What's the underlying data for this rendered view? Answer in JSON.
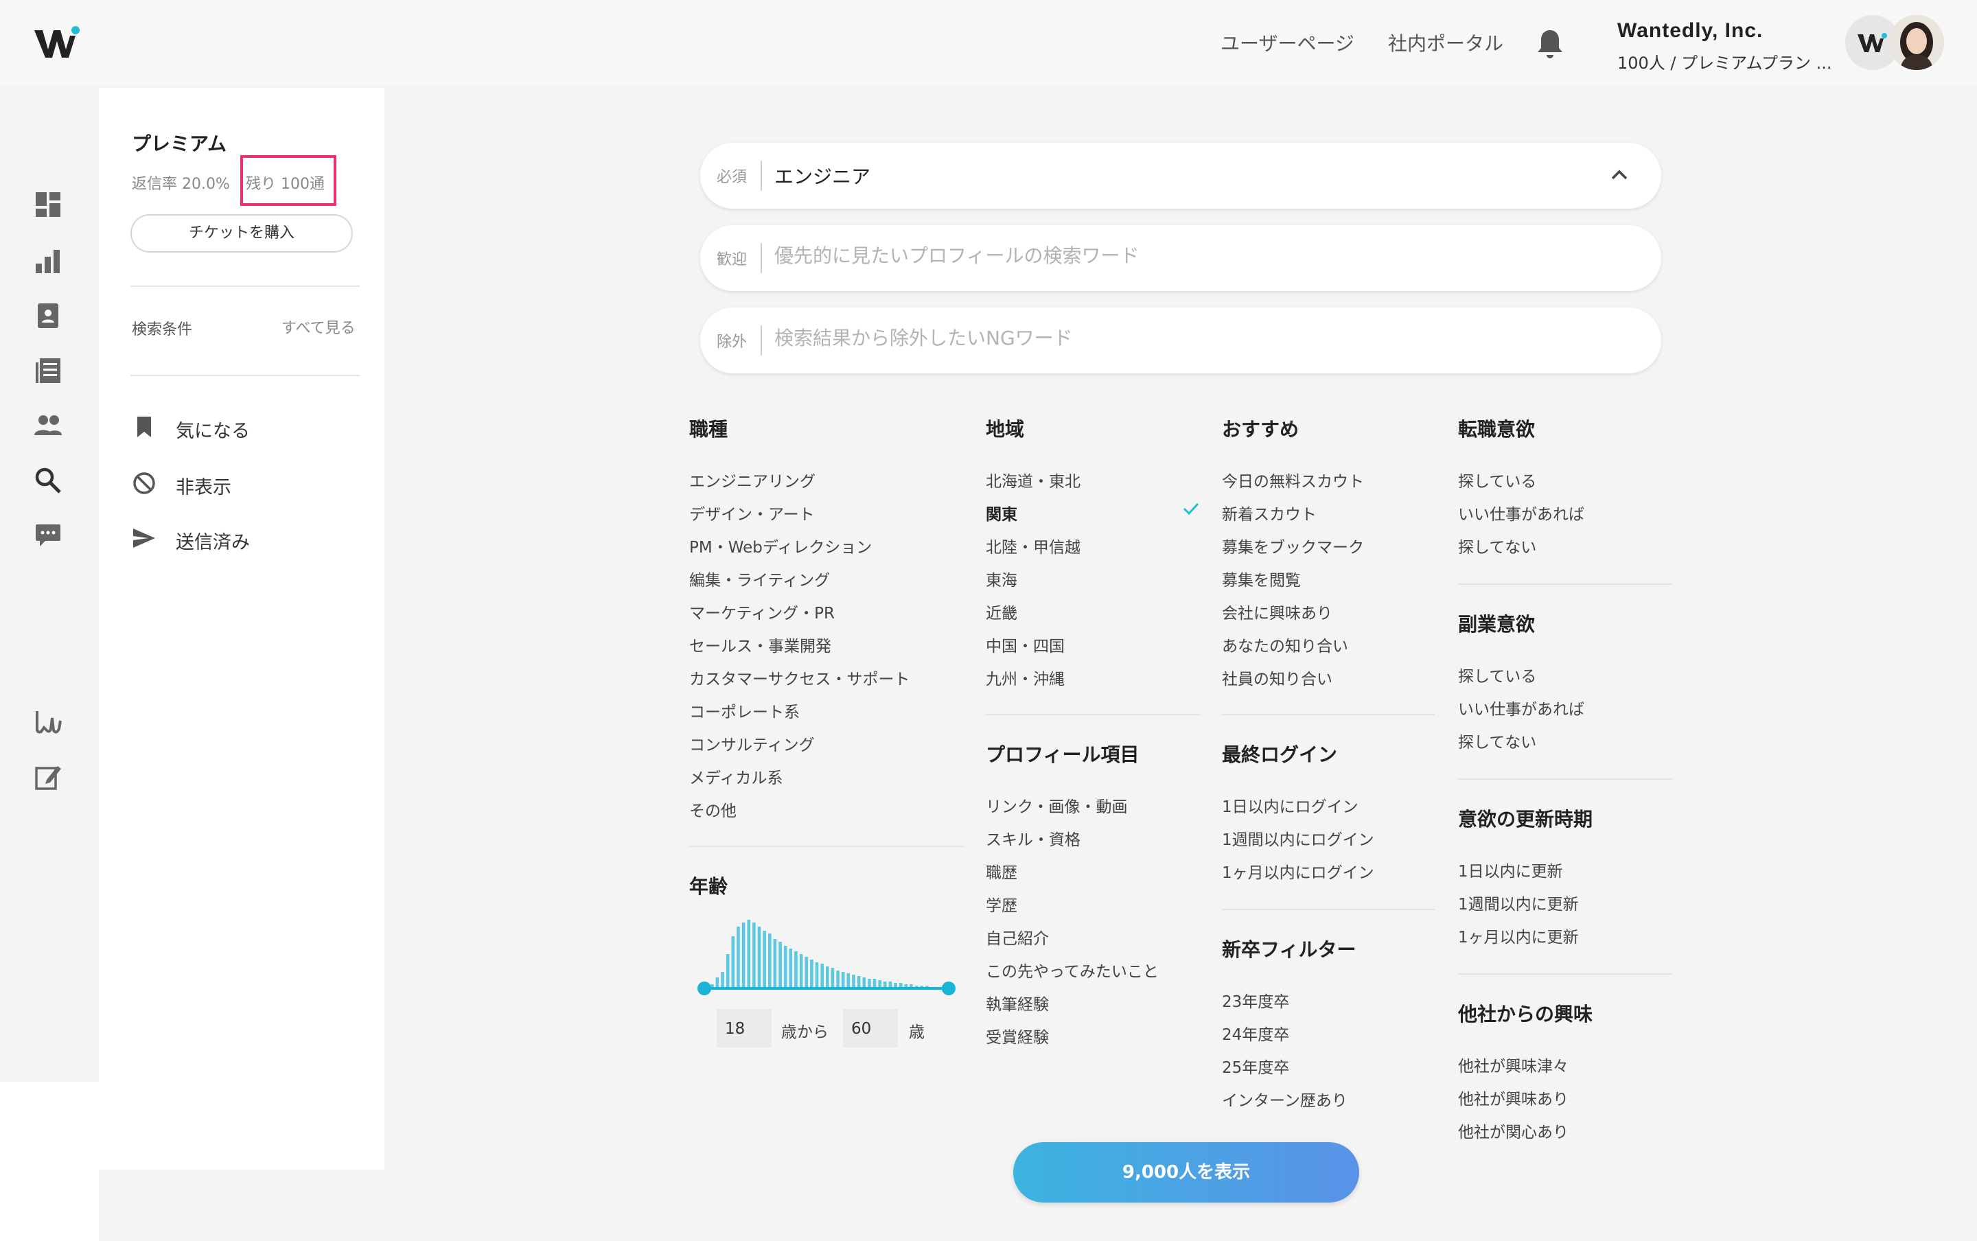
{
  "header": {
    "logo": "wantedly-logo",
    "user_page": "ユーザーページ",
    "portal": "社内ポータル",
    "company": "Wantedly, Inc.",
    "plan": "100人 / プレミアムプラン ...",
    "accent": "#21bddb"
  },
  "rail": [
    "dashboard-icon",
    "chart-icon",
    "profile-card-icon",
    "list-icon",
    "people-icon",
    "search-icon",
    "chat-icon",
    "wantedly-ws-icon",
    "edit-icon"
  ],
  "sidebar": {
    "plan_title": "プレミアム",
    "reply_rate": "返信率 20.0%",
    "remaining": "残り 100通",
    "highlight_color": "#e8336d",
    "buy_ticket": "チケットを購入",
    "conditions_label": "検索条件",
    "see_all": "すべて見る",
    "items": [
      {
        "label": "気になる",
        "icon": "bookmark-icon"
      },
      {
        "label": "非表示",
        "icon": "block-icon"
      },
      {
        "label": "送信済み",
        "icon": "send-icon"
      }
    ]
  },
  "search": {
    "required": {
      "tag": "必須",
      "value": "エンジニア"
    },
    "welcome": {
      "tag": "歓迎",
      "placeholder": "優先的に見たいプロフィールの検索ワード"
    },
    "exclude": {
      "tag": "除外",
      "placeholder": "検索結果から除外したいNGワード"
    }
  },
  "filters": {
    "job": {
      "title": "職種",
      "options": [
        "エンジニアリング",
        "デザイン・アート",
        "PM・Webディレクション",
        "編集・ライティング",
        "マーケティング・PR",
        "セールス・事業開発",
        "カスタマーサクセス・サポート",
        "コーポレート系",
        "コンサルティング",
        "メディカル系",
        "その他"
      ]
    },
    "age": {
      "title": "年齢",
      "min": "18",
      "from": "歳から",
      "max": "60",
      "unit": "歳",
      "histogram": [
        3,
        8,
        12,
        25,
        38,
        45,
        48,
        50,
        48,
        45,
        42,
        40,
        36,
        34,
        31,
        29,
        27,
        25,
        23,
        21,
        19,
        18,
        16,
        15,
        13,
        12,
        11,
        10,
        9,
        8,
        7,
        7,
        6,
        5,
        5,
        4,
        4,
        3,
        3,
        2,
        2,
        2,
        1,
        1
      ],
      "bar_color": "#5dc8df",
      "slider_color": "#1ab3d8"
    },
    "region": {
      "title": "地域",
      "options": [
        "北海道・東北",
        "関東",
        "北陸・甲信越",
        "東海",
        "近畿",
        "中国・四国",
        "九州・沖縄"
      ],
      "selected": "関東"
    },
    "profile": {
      "title": "プロフィール項目",
      "options": [
        "リンク・画像・動画",
        "スキル・資格",
        "職歴",
        "学歴",
        "自己紹介",
        "この先やってみたいこと",
        "執筆経験",
        "受賞経験"
      ]
    },
    "recommend": {
      "title": "おすすめ",
      "options": [
        "今日の無料スカウト",
        "新着スカウト",
        "募集をブックマーク",
        "募集を閲覧",
        "会社に興味あり",
        "あなたの知り合い",
        "社員の知り合い"
      ]
    },
    "last_login": {
      "title": "最終ログイン",
      "options": [
        "1日以内にログイン",
        "1週間以内にログイン",
        "1ヶ月以内にログイン"
      ]
    },
    "newgrad": {
      "title": "新卒フィルター",
      "options": [
        "23年度卒",
        "24年度卒",
        "25年度卒",
        "インターン歴あり"
      ]
    },
    "job_change": {
      "title": "転職意欲",
      "options": [
        "探している",
        "いい仕事があれば",
        "探してない"
      ]
    },
    "side_job": {
      "title": "副業意欲",
      "options": [
        "探している",
        "いい仕事があれば",
        "探してない"
      ]
    },
    "updated": {
      "title": "意欲の更新時期",
      "options": [
        "1日以内に更新",
        "1週間以内に更新",
        "1ヶ月以内に更新"
      ]
    },
    "interest": {
      "title": "他社からの興味",
      "options": [
        "他社が興味津々",
        "他社が興味あり",
        "他社が関心あり"
      ]
    }
  },
  "cta": "9,000人を表示"
}
